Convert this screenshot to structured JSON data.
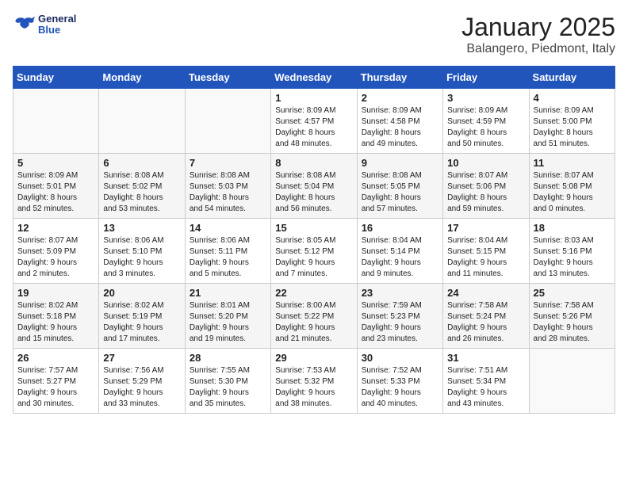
{
  "logo": {
    "line1": "General",
    "line2": "Blue"
  },
  "title": "January 2025",
  "subtitle": "Balangero, Piedmont, Italy",
  "weekdays": [
    "Sunday",
    "Monday",
    "Tuesday",
    "Wednesday",
    "Thursday",
    "Friday",
    "Saturday"
  ],
  "weeks": [
    [
      {
        "day": "",
        "info": ""
      },
      {
        "day": "",
        "info": ""
      },
      {
        "day": "",
        "info": ""
      },
      {
        "day": "1",
        "info": "Sunrise: 8:09 AM\nSunset: 4:57 PM\nDaylight: 8 hours\nand 48 minutes."
      },
      {
        "day": "2",
        "info": "Sunrise: 8:09 AM\nSunset: 4:58 PM\nDaylight: 8 hours\nand 49 minutes."
      },
      {
        "day": "3",
        "info": "Sunrise: 8:09 AM\nSunset: 4:59 PM\nDaylight: 8 hours\nand 50 minutes."
      },
      {
        "day": "4",
        "info": "Sunrise: 8:09 AM\nSunset: 5:00 PM\nDaylight: 8 hours\nand 51 minutes."
      }
    ],
    [
      {
        "day": "5",
        "info": "Sunrise: 8:09 AM\nSunset: 5:01 PM\nDaylight: 8 hours\nand 52 minutes."
      },
      {
        "day": "6",
        "info": "Sunrise: 8:08 AM\nSunset: 5:02 PM\nDaylight: 8 hours\nand 53 minutes."
      },
      {
        "day": "7",
        "info": "Sunrise: 8:08 AM\nSunset: 5:03 PM\nDaylight: 8 hours\nand 54 minutes."
      },
      {
        "day": "8",
        "info": "Sunrise: 8:08 AM\nSunset: 5:04 PM\nDaylight: 8 hours\nand 56 minutes."
      },
      {
        "day": "9",
        "info": "Sunrise: 8:08 AM\nSunset: 5:05 PM\nDaylight: 8 hours\nand 57 minutes."
      },
      {
        "day": "10",
        "info": "Sunrise: 8:07 AM\nSunset: 5:06 PM\nDaylight: 8 hours\nand 59 minutes."
      },
      {
        "day": "11",
        "info": "Sunrise: 8:07 AM\nSunset: 5:08 PM\nDaylight: 9 hours\nand 0 minutes."
      }
    ],
    [
      {
        "day": "12",
        "info": "Sunrise: 8:07 AM\nSunset: 5:09 PM\nDaylight: 9 hours\nand 2 minutes."
      },
      {
        "day": "13",
        "info": "Sunrise: 8:06 AM\nSunset: 5:10 PM\nDaylight: 9 hours\nand 3 minutes."
      },
      {
        "day": "14",
        "info": "Sunrise: 8:06 AM\nSunset: 5:11 PM\nDaylight: 9 hours\nand 5 minutes."
      },
      {
        "day": "15",
        "info": "Sunrise: 8:05 AM\nSunset: 5:12 PM\nDaylight: 9 hours\nand 7 minutes."
      },
      {
        "day": "16",
        "info": "Sunrise: 8:04 AM\nSunset: 5:14 PM\nDaylight: 9 hours\nand 9 minutes."
      },
      {
        "day": "17",
        "info": "Sunrise: 8:04 AM\nSunset: 5:15 PM\nDaylight: 9 hours\nand 11 minutes."
      },
      {
        "day": "18",
        "info": "Sunrise: 8:03 AM\nSunset: 5:16 PM\nDaylight: 9 hours\nand 13 minutes."
      }
    ],
    [
      {
        "day": "19",
        "info": "Sunrise: 8:02 AM\nSunset: 5:18 PM\nDaylight: 9 hours\nand 15 minutes."
      },
      {
        "day": "20",
        "info": "Sunrise: 8:02 AM\nSunset: 5:19 PM\nDaylight: 9 hours\nand 17 minutes."
      },
      {
        "day": "21",
        "info": "Sunrise: 8:01 AM\nSunset: 5:20 PM\nDaylight: 9 hours\nand 19 minutes."
      },
      {
        "day": "22",
        "info": "Sunrise: 8:00 AM\nSunset: 5:22 PM\nDaylight: 9 hours\nand 21 minutes."
      },
      {
        "day": "23",
        "info": "Sunrise: 7:59 AM\nSunset: 5:23 PM\nDaylight: 9 hours\nand 23 minutes."
      },
      {
        "day": "24",
        "info": "Sunrise: 7:58 AM\nSunset: 5:24 PM\nDaylight: 9 hours\nand 26 minutes."
      },
      {
        "day": "25",
        "info": "Sunrise: 7:58 AM\nSunset: 5:26 PM\nDaylight: 9 hours\nand 28 minutes."
      }
    ],
    [
      {
        "day": "26",
        "info": "Sunrise: 7:57 AM\nSunset: 5:27 PM\nDaylight: 9 hours\nand 30 minutes."
      },
      {
        "day": "27",
        "info": "Sunrise: 7:56 AM\nSunset: 5:29 PM\nDaylight: 9 hours\nand 33 minutes."
      },
      {
        "day": "28",
        "info": "Sunrise: 7:55 AM\nSunset: 5:30 PM\nDaylight: 9 hours\nand 35 minutes."
      },
      {
        "day": "29",
        "info": "Sunrise: 7:53 AM\nSunset: 5:32 PM\nDaylight: 9 hours\nand 38 minutes."
      },
      {
        "day": "30",
        "info": "Sunrise: 7:52 AM\nSunset: 5:33 PM\nDaylight: 9 hours\nand 40 minutes."
      },
      {
        "day": "31",
        "info": "Sunrise: 7:51 AM\nSunset: 5:34 PM\nDaylight: 9 hours\nand 43 minutes."
      },
      {
        "day": "",
        "info": ""
      }
    ]
  ]
}
